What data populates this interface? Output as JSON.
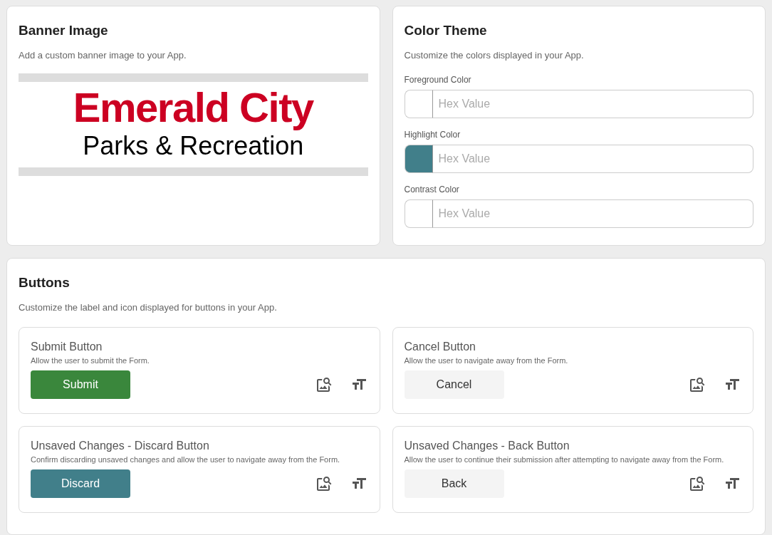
{
  "banner_card": {
    "title": "Banner Image",
    "description": "Add a custom banner image to your App.",
    "banner": {
      "title": "Emerald City",
      "subtitle": "Parks & Recreation"
    }
  },
  "color_theme": {
    "title": "Color Theme",
    "description": "Customize the colors displayed in your App.",
    "fields": [
      {
        "label": "Foreground Color",
        "placeholder": "Hex Value"
      },
      {
        "label": "Highlight Color",
        "placeholder": "Hex Value",
        "color": "#417f8a"
      },
      {
        "label": "Contrast Color",
        "placeholder": "Hex Value"
      }
    ]
  },
  "buttons_card": {
    "title": "Buttons",
    "description": "Customize the label and icon displayed for buttons in your App.",
    "items": [
      {
        "title": "Submit Button",
        "description": "Allow the user to submit the Form.",
        "button_label": "Submit",
        "color": "#3a873c",
        "kind": "filled"
      },
      {
        "title": "Cancel Button",
        "description": "Allow the user to navigate away from the Form.",
        "button_label": "Cancel",
        "color": "#f4f4f4",
        "kind": "plain"
      },
      {
        "title": "Unsaved Changes - Discard Button",
        "description": "Confirm discarding unsaved changes and allow the user to navigate away from the Form.",
        "button_label": "Discard",
        "color": "#417f8a",
        "kind": "filled"
      },
      {
        "title": "Unsaved Changes - Back Button",
        "description": "Allow the user to continue their submission after attempting to navigate away from the Form.",
        "button_label": "Back",
        "color": "#f4f4f4",
        "kind": "plain"
      }
    ]
  }
}
